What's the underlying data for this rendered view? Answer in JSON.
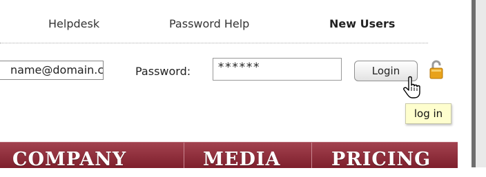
{
  "top_links": {
    "helpdesk": "Helpdesk",
    "password_help": "Password Help",
    "new_users": "New Users"
  },
  "login": {
    "email_value": "name@domain.com",
    "password_label": "Password:",
    "password_value": "******",
    "login_button": "Login",
    "tooltip": "log in"
  },
  "nav": {
    "items": [
      "Company",
      "Media",
      "Pricing"
    ]
  },
  "colors": {
    "nav_bar": "#8e2f3c",
    "lock": "#e8a21a",
    "tooltip_bg": "#fefece"
  }
}
